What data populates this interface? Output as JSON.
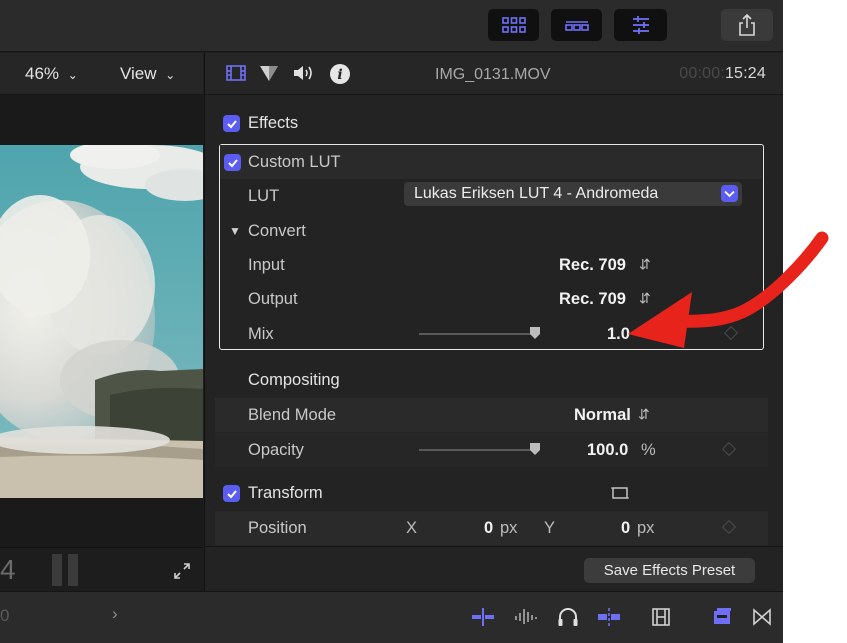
{
  "viewer": {
    "zoom_label": "46%",
    "view_label": "View",
    "timecode_fragment": "4",
    "timeline_fragment": "0"
  },
  "inspector": {
    "clip_name": "IMG_0131.MOV",
    "timecode_dim": "00:00:",
    "timecode_lit": "15:24",
    "effects_label": "Effects",
    "custom_lut_label": "Custom LUT",
    "lut_label": "LUT",
    "lut_value": "Lukas Eriksen LUT 4 - Andromeda",
    "convert_label": "Convert",
    "input_label": "Input",
    "input_value": "Rec. 709",
    "output_label": "Output",
    "output_value": "Rec. 709",
    "mix_label": "Mix",
    "mix_value": "1.0",
    "mix_level": 1.0,
    "compositing_label": "Compositing",
    "blend_mode_label": "Blend Mode",
    "blend_mode_value": "Normal",
    "opacity_label": "Opacity",
    "opacity_value": "100.0",
    "opacity_unit": "%",
    "opacity_level": 1.0,
    "transform_label": "Transform",
    "position_label": "Position",
    "x_label": "X",
    "x_value": "0",
    "x_unit": "px",
    "y_label": "Y",
    "y_value": "0",
    "y_unit": "px",
    "save_preset_label": "Save Effects Preset"
  },
  "colors": {
    "accent": "#5b5df2",
    "annotation_arrow": "#e8231c",
    "panel_bg": "#232323"
  },
  "icons": {
    "toolbar": [
      "browser-grid-icon",
      "timeline-strip-icon",
      "inspector-sliders-icon",
      "share-icon"
    ],
    "inspector_tabs": [
      "video-inspector-icon",
      "color-inspector-icon",
      "audio-inspector-icon",
      "info-inspector-icon"
    ],
    "bottom": [
      "chevron-right-icon",
      "audio-skimming-icon",
      "audio-waveform-icon",
      "headphones-icon",
      "snapping-icon",
      "filmstrip-icon",
      "effects-browser-icon",
      "transitions-icon"
    ]
  }
}
